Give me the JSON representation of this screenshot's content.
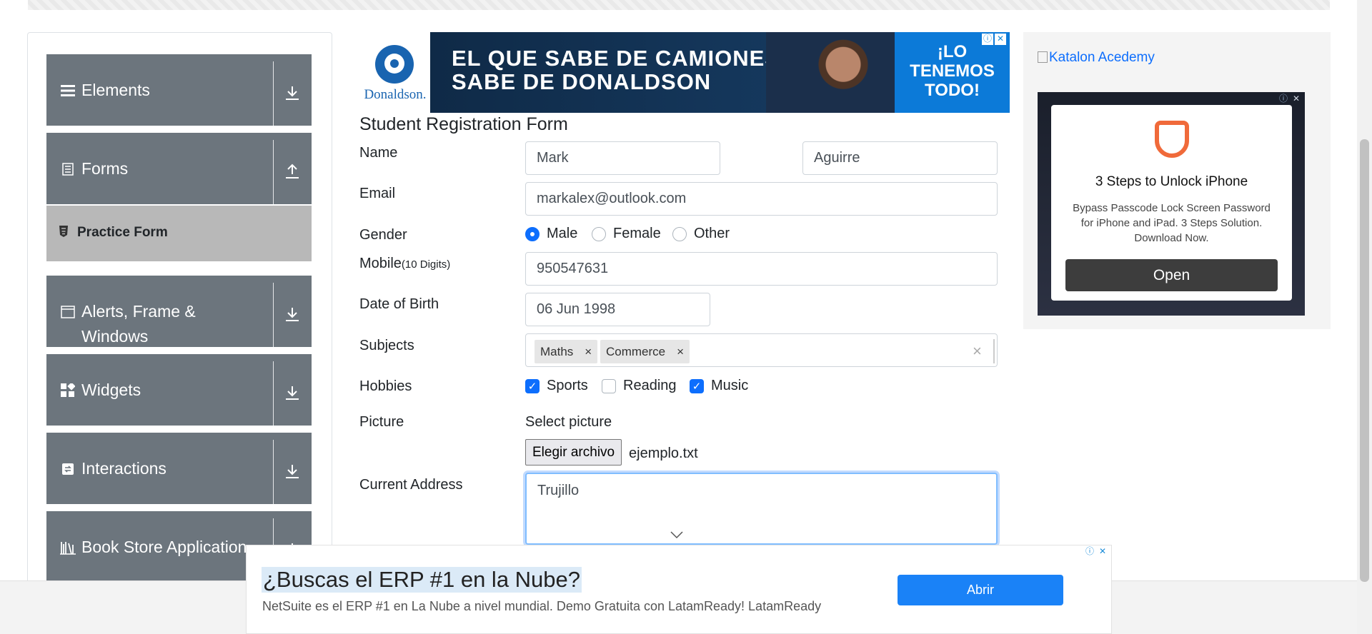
{
  "sidebar": {
    "groups": [
      {
        "label": "Elements",
        "icon": "hamburger-icon",
        "arrow": "download-arrow-icon"
      },
      {
        "label": "Forms",
        "icon": "document-icon",
        "arrow": "upload-arrow-icon"
      },
      {
        "label_line1": "Alerts, Frame &",
        "label_line2": "Windows",
        "icon": "window-icon",
        "arrow": "download-arrow-icon"
      },
      {
        "label": "Widgets",
        "icon": "grid-icon",
        "arrow": "download-arrow-icon"
      },
      {
        "label": "Interactions",
        "icon": "refresh-icon",
        "arrow": "download-arrow-icon"
      },
      {
        "label": "Book Store Application",
        "icon": "books-icon",
        "arrow": "download-arrow-icon"
      }
    ],
    "active_item": {
      "label": "Practice Form",
      "icon": "html5-icon"
    }
  },
  "ad_top": {
    "brand": "Donaldson.",
    "line1": "EL QUE SABE DE CAMIONES",
    "line2": "SABE DE DONALDSON",
    "right1": "¡LO",
    "right2": "TENEMOS",
    "right3": "TODO!"
  },
  "form": {
    "title": "Student Registration Form",
    "labels": {
      "name": "Name",
      "email": "Email",
      "gender": "Gender",
      "mobile": "Mobile",
      "mobile_hint": "(10 Digits)",
      "dob": "Date of Birth",
      "subjects": "Subjects",
      "hobbies": "Hobbies",
      "picture": "Picture",
      "address": "Current Address"
    },
    "first_name": "Mark",
    "last_name": "Aguirre",
    "email": "markalex@outlook.com",
    "gender_options": [
      "Male",
      "Female",
      "Other"
    ],
    "gender_selected": "Male",
    "mobile": "950547631",
    "dob": "06 Jun 1998",
    "subjects": [
      "Maths",
      "Commerce"
    ],
    "hobbies": [
      {
        "label": "Sports",
        "checked": true
      },
      {
        "label": "Reading",
        "checked": false
      },
      {
        "label": "Music",
        "checked": true
      }
    ],
    "select_picture": "Select picture",
    "file_button": "Elegir archivo",
    "file_name": "ejemplo.txt",
    "address": "Trujillo"
  },
  "right_ad": {
    "katalon_link": "Katalon Acedemy",
    "heading": "3 Steps to Unlock iPhone",
    "body": "Bypass Passcode Lock Screen Password for iPhone and iPad. 3 Steps Solution. Download Now.",
    "button": "Open"
  },
  "bottom_ad": {
    "heading": "¿Buscas el ERP #1 en la Nube?",
    "body": "NetSuite es el ERP #1 en La Nube a nivel mundial. Demo Gratuita con LatamReady! LatamReady",
    "button": "Abrir"
  },
  "colors": {
    "sidebar_group": "#6c757d",
    "active_item": "#b8b8b8",
    "primary": "#0d6efd",
    "bottom_ad_button": "#1a82f7"
  }
}
